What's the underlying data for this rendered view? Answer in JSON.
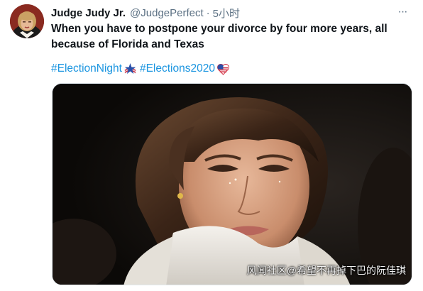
{
  "tweet": {
    "author_name": "Judge Judy Jr.",
    "handle": "@JudgePerfect",
    "separator": "·",
    "time": "5小时",
    "more_label": "···",
    "text": "When you have to postpone your divorce by four more years, all because of Florida and Texas",
    "hashtags": [
      {
        "text": "#ElectionNight",
        "emoji": "star-flag-emoji"
      },
      {
        "text": "#Elections2020",
        "emoji": "flag-heart-emoji"
      }
    ]
  },
  "media": {
    "watermark": "风闻社区@希望不再掉下巴的阮佳琪"
  },
  "colors": {
    "link": "#1b95e0",
    "secondary": "#5b7083",
    "text": "#0f1419"
  }
}
